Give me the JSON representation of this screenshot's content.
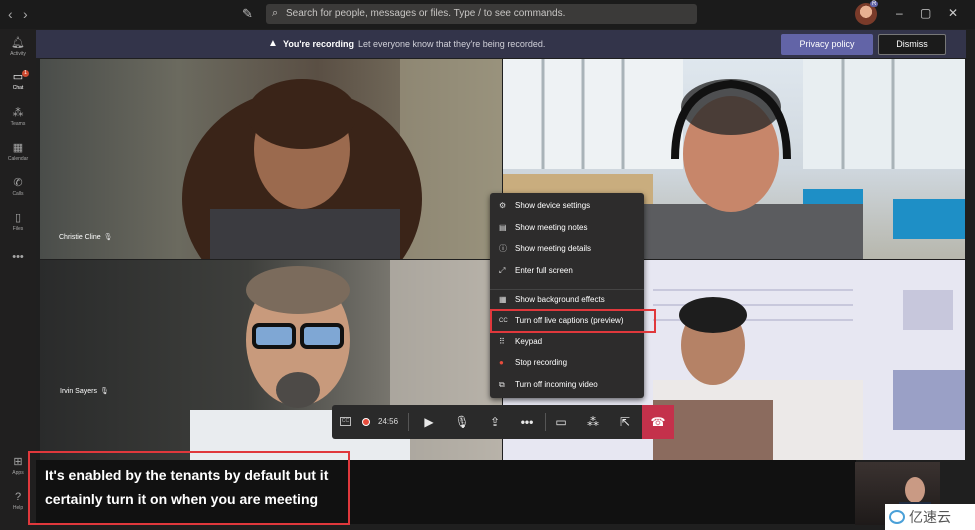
{
  "titlebar": {
    "back": "‹",
    "forward": "›",
    "search_placeholder": "Search for people, messages or files. Type / to see commands.",
    "avatar_badge": "R",
    "minimize": "–",
    "maximize": "▢",
    "close": "✕"
  },
  "rail": {
    "items": [
      {
        "label": "Activity",
        "icon": "bell-icon",
        "glyph": "🔔"
      },
      {
        "label": "Chat",
        "icon": "chat-icon",
        "glyph": "💬",
        "badge": "1"
      },
      {
        "label": "Teams",
        "icon": "teams-icon",
        "glyph": "👥"
      },
      {
        "label": "Calendar",
        "icon": "calendar-icon",
        "glyph": "📅"
      },
      {
        "label": "Calls",
        "icon": "phone-icon",
        "glyph": "📞"
      },
      {
        "label": "Files",
        "icon": "file-icon",
        "glyph": "📄"
      },
      {
        "label": "",
        "icon": "more-icon",
        "glyph": "•••"
      },
      {
        "label": "Apps",
        "icon": "apps-icon",
        "glyph": "⊞"
      },
      {
        "label": "Help",
        "icon": "help-icon",
        "glyph": "?"
      }
    ]
  },
  "banner": {
    "title": "You're recording",
    "message": "Let everyone know that they're being recorded.",
    "privacy_button": "Privacy policy",
    "dismiss_button": "Dismiss"
  },
  "participants": {
    "p1": "Christie Cline",
    "p2": "Irvin Sayers"
  },
  "menu": {
    "items": [
      {
        "label": "Show device settings",
        "icon": "gear-icon",
        "glyph": "⚙"
      },
      {
        "label": "Show meeting notes",
        "icon": "notes-icon",
        "glyph": "▤"
      },
      {
        "label": "Show meeting details",
        "icon": "info-icon",
        "glyph": "ⓘ"
      },
      {
        "label": "Enter full screen",
        "icon": "fullscreen-icon",
        "glyph": "⤢"
      },
      {
        "label": "Show background effects",
        "icon": "background-effects-icon",
        "glyph": "▦"
      },
      {
        "label": "Turn off live captions (preview)",
        "icon": "captions-icon",
        "glyph": "CC"
      },
      {
        "label": "Keypad",
        "icon": "keypad-icon",
        "glyph": "⠿"
      },
      {
        "label": "Stop recording",
        "icon": "record-icon",
        "glyph": "●"
      },
      {
        "label": "Turn off incoming video",
        "icon": "video-off-icon",
        "glyph": "⧉"
      }
    ]
  },
  "controls": {
    "timer": "24:56",
    "cc": "CC"
  },
  "caption": {
    "text": "It's enabled by the tenants by default but it certainly turn it on when you are meeting"
  },
  "watermark": {
    "text": "亿速云"
  },
  "colors": {
    "accent": "#6264a7",
    "record": "#e74c3c",
    "highlight": "#e0383c",
    "hangup": "#c4314b"
  }
}
